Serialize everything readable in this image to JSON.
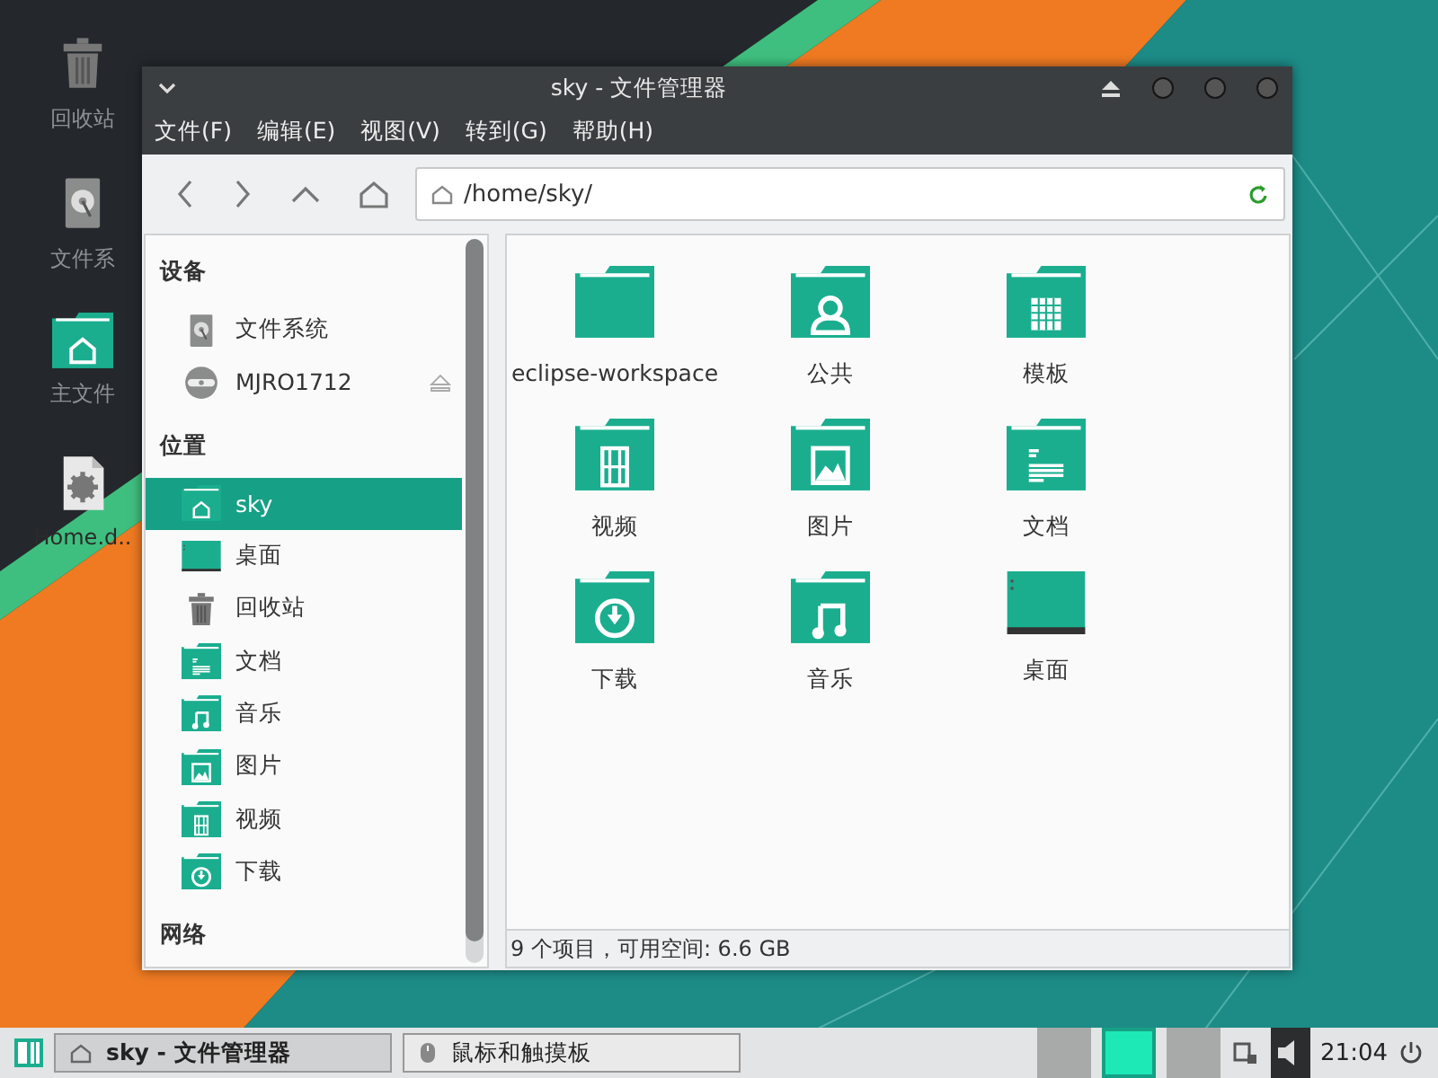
{
  "desktop_icons": [
    {
      "label": "回收站",
      "kind": "trash"
    },
    {
      "label": "文件系",
      "kind": "drive"
    },
    {
      "label": "主文件",
      "kind": "home"
    },
    {
      "label": "Home.d..",
      "kind": "settings-file"
    }
  ],
  "window": {
    "title": "sky - 文件管理器"
  },
  "menu": [
    "文件(F)",
    "编辑(E)",
    "视图(V)",
    "转到(G)",
    "帮助(H)"
  ],
  "location": {
    "value": "/home/sky/"
  },
  "sidebar": [
    {
      "heading": "设备",
      "items": [
        {
          "label": "文件系统",
          "kind": "drive",
          "selected": false,
          "ejectable": false
        },
        {
          "label": "MJRO1712",
          "kind": "disc",
          "selected": false,
          "ejectable": true
        }
      ]
    },
    {
      "heading": "位置",
      "items": [
        {
          "label": "sky",
          "kind": "home",
          "selected": true,
          "ejectable": false
        },
        {
          "label": "桌面",
          "kind": "desktop",
          "selected": false,
          "ejectable": false
        },
        {
          "label": "回收站",
          "kind": "trash",
          "selected": false,
          "ejectable": false
        },
        {
          "label": "文档",
          "kind": "documents",
          "selected": false,
          "ejectable": false
        },
        {
          "label": "音乐",
          "kind": "music",
          "selected": false,
          "ejectable": false
        },
        {
          "label": "图片",
          "kind": "pictures",
          "selected": false,
          "ejectable": false
        },
        {
          "label": "视频",
          "kind": "video",
          "selected": false,
          "ejectable": false
        },
        {
          "label": "下载",
          "kind": "download",
          "selected": false,
          "ejectable": false
        }
      ]
    },
    {
      "heading": "网络"
    }
  ],
  "files": [
    {
      "label": "eclipse-workspace",
      "kind": "folder"
    },
    {
      "label": "公共",
      "kind": "public"
    },
    {
      "label": "模板",
      "kind": "templates"
    },
    {
      "label": "视频",
      "kind": "video"
    },
    {
      "label": "图片",
      "kind": "pictures"
    },
    {
      "label": "文档",
      "kind": "documents"
    },
    {
      "label": "下载",
      "kind": "download"
    },
    {
      "label": "音乐",
      "kind": "music"
    },
    {
      "label": "桌面",
      "kind": "desktop"
    }
  ],
  "status_bar": "9 个项目，可用空间: 6.6 GB",
  "taskbar": {
    "tasks": [
      {
        "label": "sky - 文件管理器",
        "kind": "folder",
        "selected": true
      },
      {
        "label": "鼠标和触摸板",
        "kind": "mouse",
        "selected": false
      }
    ],
    "workspaces": [
      {
        "selected": false
      },
      {
        "selected": true
      },
      {
        "selected": false
      }
    ],
    "clock": "21:04"
  }
}
